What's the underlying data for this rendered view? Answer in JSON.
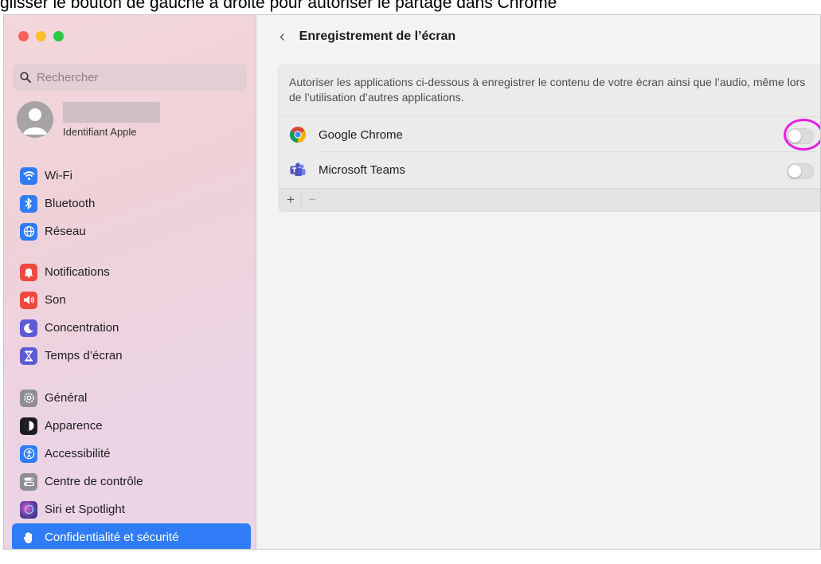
{
  "caption": "glisser le bouton de gauche à droite pour autoriser le partage dans Chrome",
  "search": {
    "placeholder": "Rechercher"
  },
  "account": {
    "subtitle": "Identifiant Apple"
  },
  "sidebar": {
    "group1": [
      {
        "label": "Wi-Fi",
        "icon": "wifi-icon",
        "color": "#2f7cf6"
      },
      {
        "label": "Bluetooth",
        "icon": "bluetooth-icon",
        "color": "#2f7cf6"
      },
      {
        "label": "Réseau",
        "icon": "globe-icon",
        "color": "#2f7cf6"
      }
    ],
    "group2": [
      {
        "label": "Notifications",
        "icon": "bell-icon",
        "color": "#f0483e"
      },
      {
        "label": "Son",
        "icon": "speaker-icon",
        "color": "#f0483e"
      },
      {
        "label": "Concentration",
        "icon": "moon-icon",
        "color": "#5b5bd6"
      },
      {
        "label": "Temps d’écran",
        "icon": "hourglass-icon",
        "color": "#5b5bd6"
      }
    ],
    "group3": [
      {
        "label": "Général",
        "icon": "gear-icon",
        "color": "#8e8e93"
      },
      {
        "label": "Apparence",
        "icon": "appearance-icon",
        "color": "#1d1d1f"
      },
      {
        "label": "Accessibilité",
        "icon": "accessibility-icon",
        "color": "#2f7cf6"
      },
      {
        "label": "Centre de contrôle",
        "icon": "control-center-icon",
        "color": "#8e8e93"
      },
      {
        "label": "Siri et Spotlight",
        "icon": "siri-icon",
        "color": "#3a3a8c"
      },
      {
        "label": "Confidentialité et sécurité",
        "icon": "hand-icon",
        "color": "#2f7cf6",
        "active": true
      }
    ]
  },
  "main": {
    "title": "Enregistrement de l’écran",
    "description": "Autoriser les applications ci-dessous à enregistrer le contenu de votre écran ainsi que l’audio, même lors de l’utilisation d’autres applications.",
    "apps": [
      {
        "name": "Google Chrome",
        "icon": "chrome-icon",
        "enabled": false
      },
      {
        "name": "Microsoft Teams",
        "icon": "teams-icon",
        "enabled": false
      }
    ],
    "add_label": "+",
    "remove_label": "−"
  },
  "colors": {
    "accent": "#2f7cf6",
    "highlight": "#e51ee5"
  }
}
